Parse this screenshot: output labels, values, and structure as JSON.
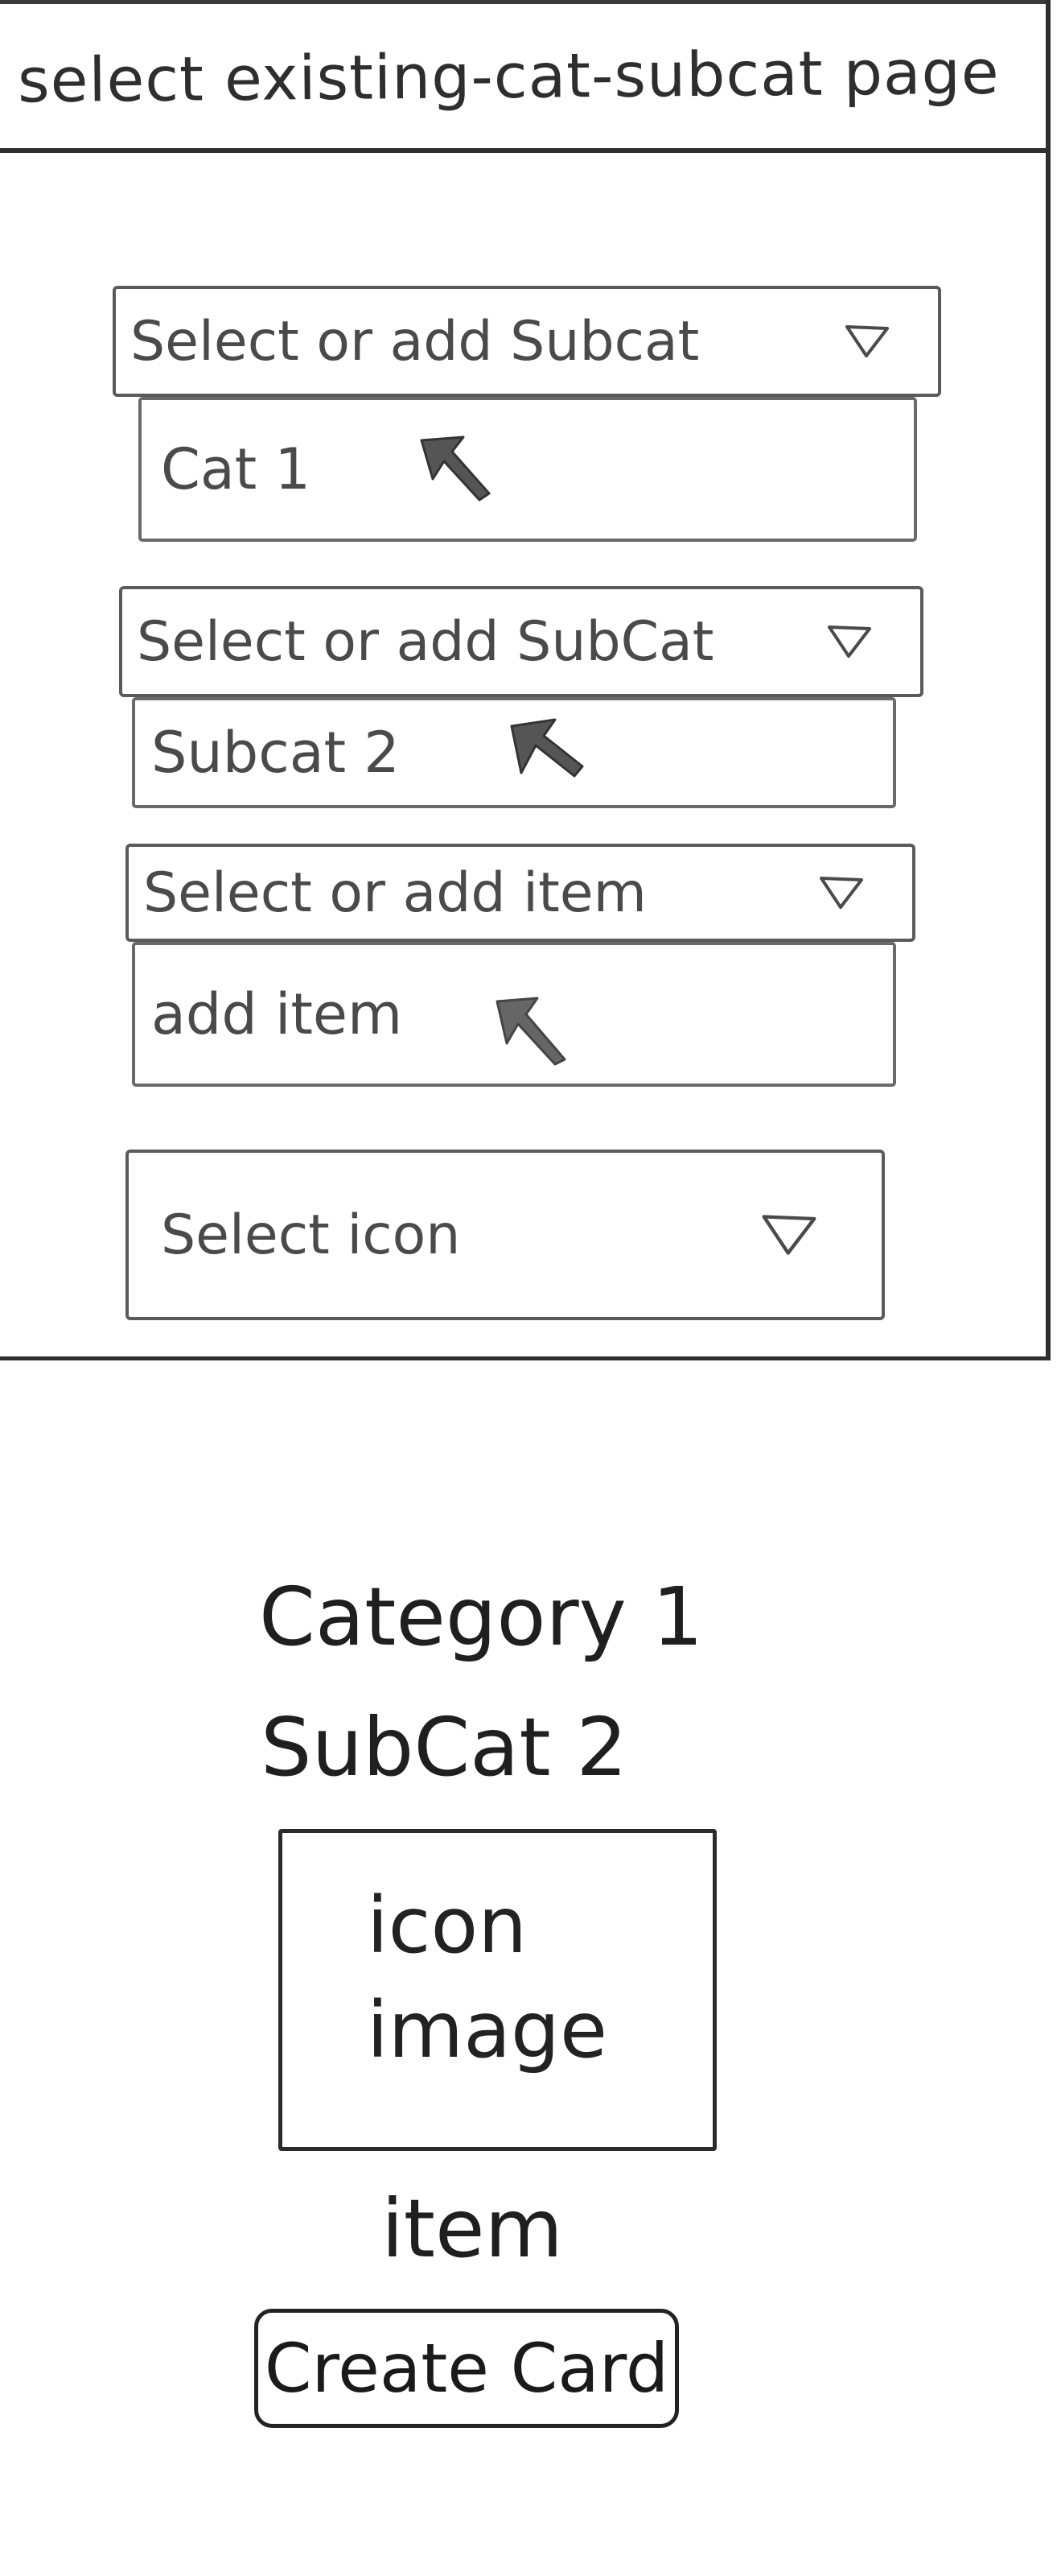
{
  "wireframe": {
    "title": "select existing-cat-subcat page",
    "dropdowns": [
      {
        "label": "Select or add Subcat",
        "value": "Cat 1"
      },
      {
        "label": "Select or add SubCat",
        "value": "Subcat 2"
      },
      {
        "label": "Select or add item",
        "value": "add item"
      },
      {
        "label": "Select icon"
      }
    ]
  },
  "card_preview": {
    "category": "Category 1",
    "subcategory": "SubCat 2",
    "icon_placeholder": "icon\nimage",
    "item": "item",
    "create_button_label": "Create Card"
  }
}
